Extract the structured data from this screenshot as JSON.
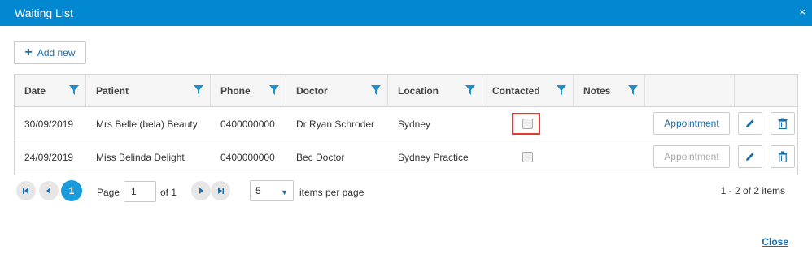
{
  "dialog": {
    "title": "Waiting List",
    "close_glyph": "×"
  },
  "toolbar": {
    "add_label": "Add new"
  },
  "columns": [
    {
      "label": "Date"
    },
    {
      "label": "Patient"
    },
    {
      "label": "Phone"
    },
    {
      "label": "Doctor"
    },
    {
      "label": "Location"
    },
    {
      "label": "Contacted"
    },
    {
      "label": "Notes"
    }
  ],
  "rows": [
    {
      "date": "30/09/2019",
      "patient": "Mrs Belle (bela) Beauty",
      "phone": "0400000000",
      "doctor": "Dr Ryan Schroder",
      "location": "Sydney",
      "contacted": false,
      "appointment_label": "Appointment",
      "appointment_enabled": true
    },
    {
      "date": "24/09/2019",
      "patient": "Miss Belinda Delight",
      "phone": "0400000000",
      "doctor": "Bec Doctor",
      "location": "Sydney Practice",
      "contacted": false,
      "appointment_label": "Appointment",
      "appointment_enabled": false
    }
  ],
  "pager": {
    "page_label": "Page",
    "page_value": "1",
    "of_label": "of 1",
    "current_page": "1",
    "per_page_value": "5",
    "per_page_label": "items per page",
    "summary": "1 - 2 of 2 items"
  },
  "footer": {
    "close_label": "Close"
  },
  "colors": {
    "accent": "#0288d1",
    "link": "#1a6ea8",
    "highlight": "#e53935"
  },
  "icons": [
    "close-icon",
    "plus-icon",
    "filter-icon",
    "pencil-icon",
    "trash-icon",
    "first-page-icon",
    "prev-page-icon",
    "next-page-icon",
    "last-page-icon",
    "chevron-down-icon"
  ]
}
